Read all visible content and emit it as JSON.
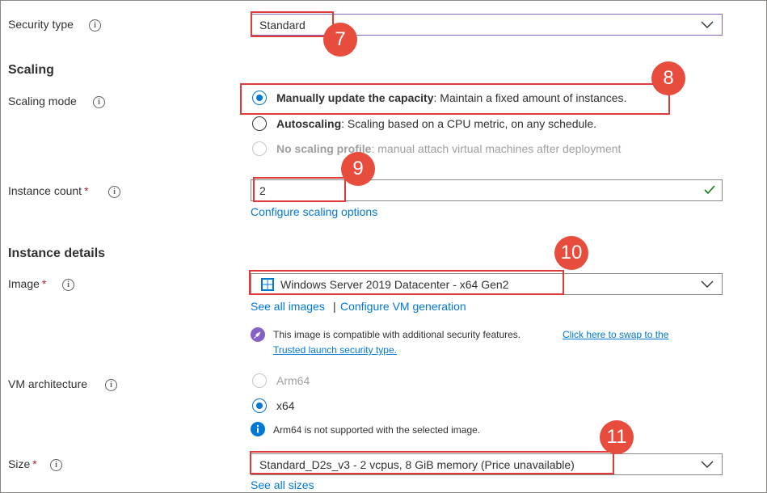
{
  "security_type": {
    "label": "Security type",
    "value": "Standard"
  },
  "scaling": {
    "heading": "Scaling",
    "mode_label": "Scaling mode",
    "options": [
      {
        "title": "Manually update the capacity",
        "desc": ": Maintain a fixed amount of instances.",
        "selected": true,
        "disabled": false
      },
      {
        "title": "Autoscaling",
        "desc": ": Scaling based on a CPU metric, on any schedule.",
        "selected": false,
        "disabled": false
      },
      {
        "title": "No scaling profile",
        "desc": ": manual attach virtual machines after deployment",
        "selected": false,
        "disabled": true
      }
    ],
    "instance_count_label": "Instance count",
    "instance_count": "2",
    "configure_link": "Configure scaling options"
  },
  "instance_details": {
    "heading": "Instance details",
    "image_label": "Image",
    "image_value": "Windows Server 2019 Datacenter - x64 Gen2",
    "see_all_images": "See all images",
    "separator": "|",
    "configure_vm_generation": "Configure VM generation",
    "compat_text": "This image is compatible with additional security features.",
    "compat_link_1": "Click here to swap to the",
    "compat_link_2": "Trusted launch security type.",
    "arch_label": "VM architecture",
    "arch_options": [
      {
        "label": "Arm64",
        "selected": false,
        "disabled": true
      },
      {
        "label": "x64",
        "selected": true,
        "disabled": false
      }
    ],
    "arch_info_bold": "Arm64",
    "arch_info": " is not supported with the selected image.",
    "size_label": "Size",
    "size_value": "Standard_D2s_v3 - 2 vcpus, 8 GiB memory (Price unavailable)",
    "see_all_sizes": "See all sizes"
  },
  "required_mark": "*",
  "info_glyph": "i",
  "callouts": [
    "7",
    "8",
    "9",
    "10",
    "11"
  ],
  "colors": {
    "accent": "#0078d4",
    "callout": "#e74c3c",
    "highlight_box": "#e03a3a",
    "success": "#107c10",
    "rocket": "#8661c5"
  }
}
